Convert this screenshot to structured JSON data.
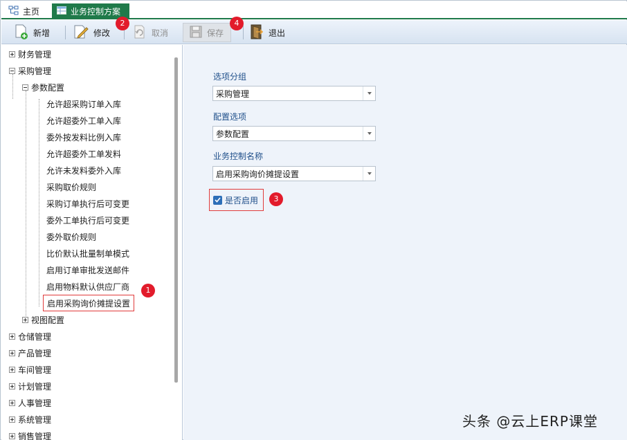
{
  "tabs": {
    "home_label": "主页",
    "active_label": "业务控制方案"
  },
  "toolbar": {
    "add_label": "新增",
    "edit_label": "修改",
    "cancel_label": "取消",
    "save_label": "保存",
    "exit_label": "退出"
  },
  "tree": {
    "top_nodes": [
      "财务管理",
      "采购管理",
      "仓储管理",
      "产品管理",
      "车间管理",
      "计划管理",
      "人事管理",
      "系统管理",
      "销售管理"
    ],
    "purchase_children": [
      "参数配置",
      "视图配置"
    ],
    "param_items": [
      "允许超采购订单入库",
      "允许超委外工单入库",
      "委外按发料比例入库",
      "允许超委外工单发料",
      "允许未发料委外入库",
      "采购取价规则",
      "采购订单执行后可变更",
      "委外工单执行后可变更",
      "委外取价规则",
      "比价默认批量制单模式",
      "启用订单审批发送邮件",
      "启用物料默认供应厂商",
      "启用采购询价摊提设置"
    ]
  },
  "form": {
    "group_label": "选项分组",
    "group_value": "采购管理",
    "config_label": "配置选项",
    "config_value": "参数配置",
    "name_label": "业务控制名称",
    "name_value": "启用采购询价摊提设置",
    "enable_label": "是否启用",
    "enable_checked": true
  },
  "annotations": [
    "1",
    "2",
    "3",
    "4"
  ],
  "watermark": "头条 @云上ERP课堂",
  "colors": {
    "tab_active": "#1f7a4a",
    "badge": "#e21b2b",
    "content_bg": "#eef3fa",
    "label_blue": "#1f4f8a"
  }
}
